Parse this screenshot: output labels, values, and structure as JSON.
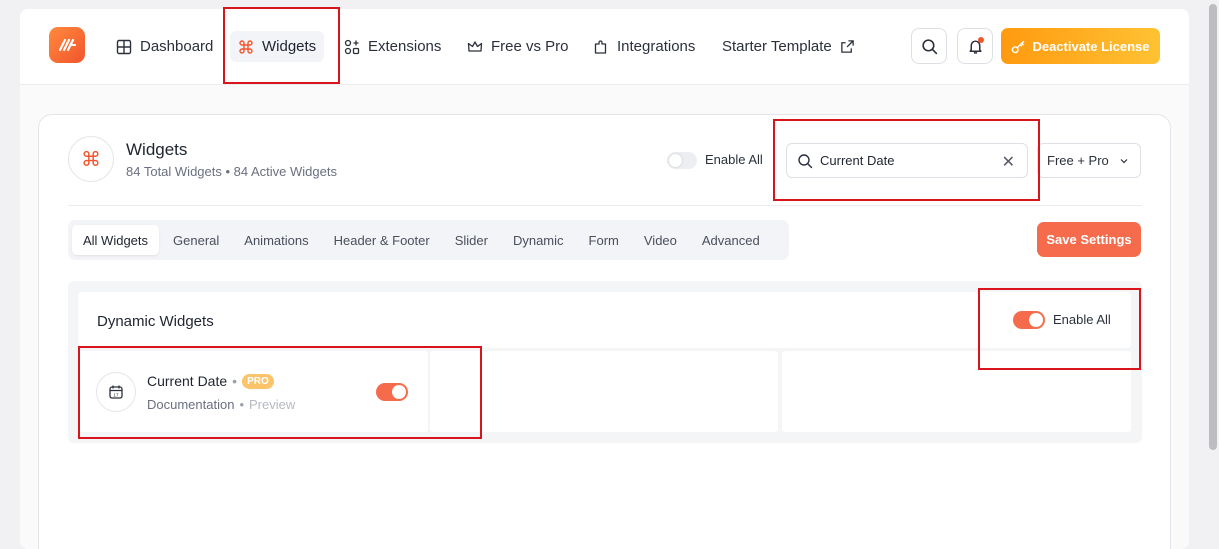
{
  "nav": {
    "items": [
      {
        "label": "Dashboard",
        "icon": "grid-icon"
      },
      {
        "label": "Widgets",
        "icon": "command-icon",
        "active": true
      },
      {
        "label": "Extensions",
        "icon": "extensions-icon"
      },
      {
        "label": "Free vs Pro",
        "icon": "crown-icon"
      },
      {
        "label": "Integrations",
        "icon": "puzzle-icon"
      },
      {
        "label": "Starter Template",
        "icon": "external-link-icon"
      }
    ],
    "deactivate_label": "Deactivate License"
  },
  "widgets_header": {
    "title": "Widgets",
    "subtitle": "84 Total Widgets • 84 Active Widgets",
    "enable_all_label": "Enable All",
    "search_value": "Current Date",
    "filter_value": "Free + Pro"
  },
  "tabs": [
    "All Widgets",
    "General",
    "Animations",
    "Header & Footer",
    "Slider",
    "Dynamic",
    "Form",
    "Video",
    "Advanced"
  ],
  "save_label": "Save Settings",
  "group": {
    "title": "Dynamic Widgets",
    "enable_all_label": "Enable All",
    "widget": {
      "name": "Current Date",
      "badge": "PRO",
      "doc_label": "Documentation",
      "preview_label": "Preview",
      "enabled": true
    }
  },
  "colors": {
    "accent": "#f56b4c",
    "deactivate_gradient_start": "#ff9a10",
    "deactivate_gradient_end": "#ffc233",
    "highlight": "#d9141c",
    "pro_badge": "#fcc46a"
  }
}
